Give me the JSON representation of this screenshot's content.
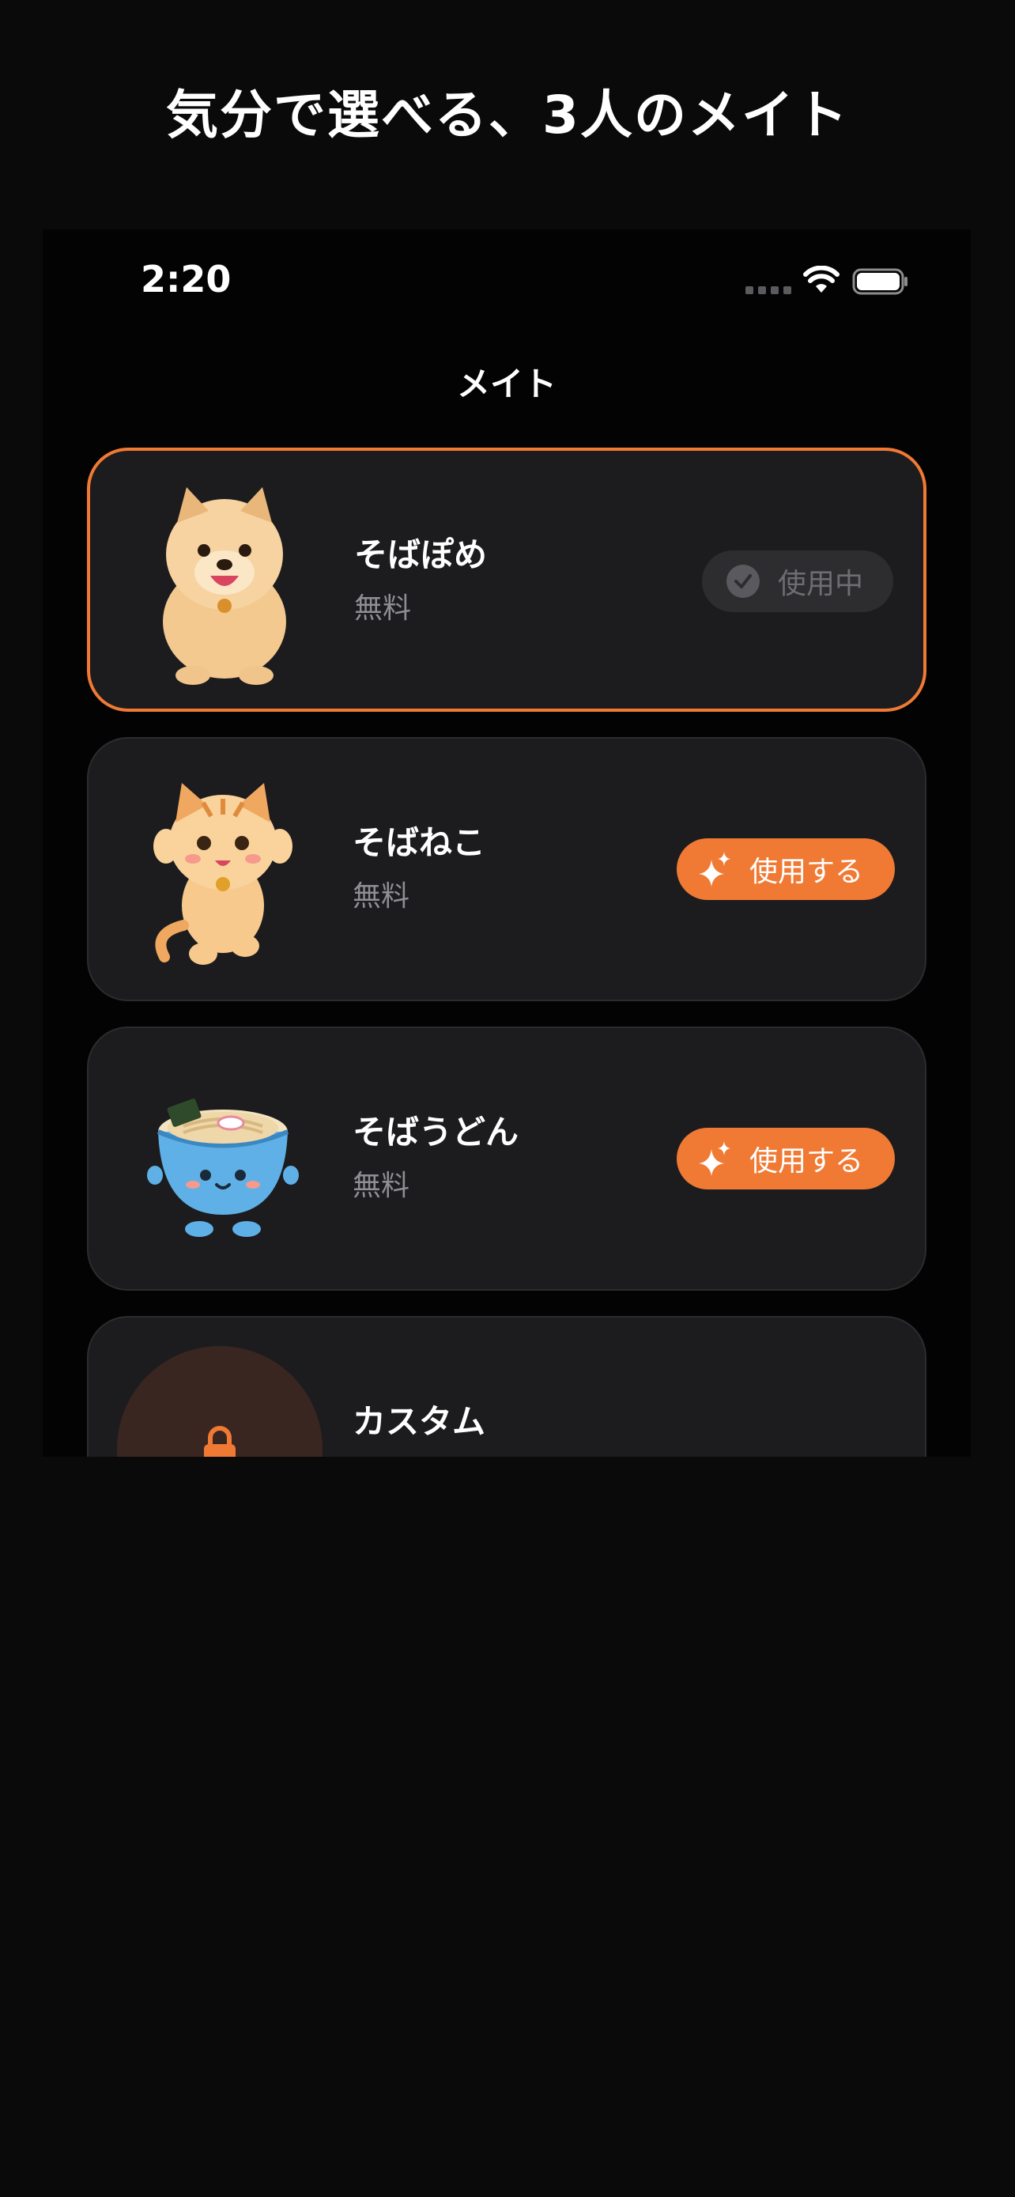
{
  "promo": {
    "title": "気分で選べる、3人のメイト"
  },
  "status_bar": {
    "time": "2:20",
    "icons": [
      "cellular-icon",
      "wifi-icon",
      "battery-icon"
    ]
  },
  "nav": {
    "title": "メイト"
  },
  "mates": [
    {
      "name": "そばぽめ",
      "price": "無料",
      "button_label": "使用中",
      "state": "in-use",
      "icon": "pomeranian-icon"
    },
    {
      "name": "そばねこ",
      "price": "無料",
      "button_label": "使用する",
      "state": "available",
      "icon": "cat-icon"
    },
    {
      "name": "そばうどん",
      "price": "無料",
      "button_label": "使用する",
      "state": "available",
      "icon": "udon-bowl-icon"
    }
  ],
  "custom": {
    "name": "カスタム",
    "icon": "lock-icon"
  },
  "colors": {
    "accent": "#f07a34",
    "card": "#1c1c1e",
    "background": "#0a0a0b"
  }
}
